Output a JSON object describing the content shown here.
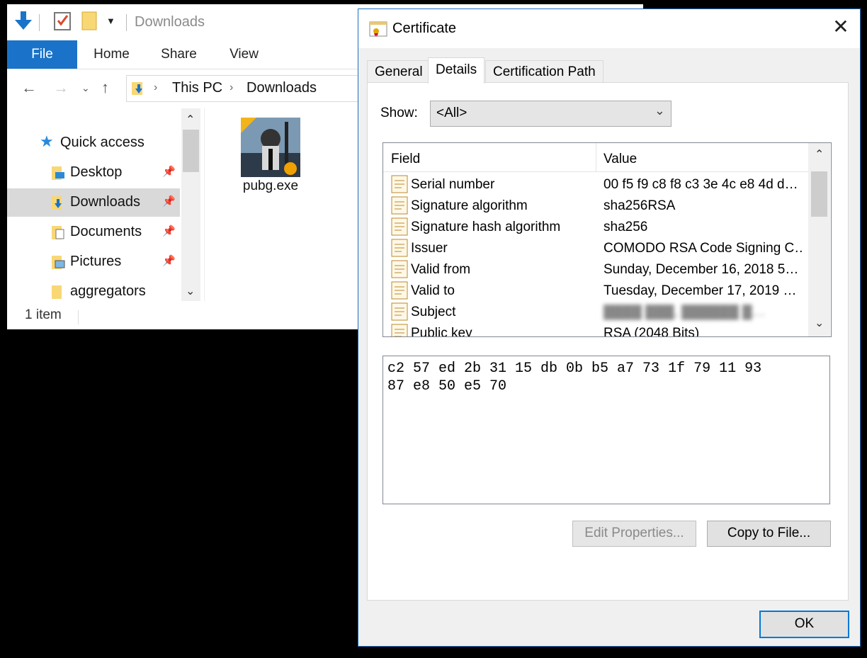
{
  "explorer": {
    "title": "Downloads",
    "ribbon_tabs": [
      "File",
      "Home",
      "Share",
      "View"
    ],
    "breadcrumb": [
      "This PC",
      "Downloads"
    ],
    "quick_access": {
      "label": "Quick access",
      "items": [
        {
          "label": "Desktop",
          "pinned": true
        },
        {
          "label": "Downloads",
          "pinned": true,
          "selected": true
        },
        {
          "label": "Documents",
          "pinned": true
        },
        {
          "label": "Pictures",
          "pinned": true
        },
        {
          "label": "aggregators",
          "pinned": false
        }
      ]
    },
    "files": [
      {
        "name": "pubg.exe",
        "icon": "pubg-game-icon"
      }
    ],
    "status": "1 item"
  },
  "certificate": {
    "title": "Certificate",
    "tabs": [
      "General",
      "Details",
      "Certification Path"
    ],
    "active_tab": "Details",
    "show_label": "Show:",
    "show_value": "<All>",
    "columns": {
      "field": "Field",
      "value": "Value"
    },
    "rows": [
      {
        "field": "Serial number",
        "value": "00 f5 f9 c8 f8 c3 3e 4c e8 4d d…"
      },
      {
        "field": "Signature algorithm",
        "value": "sha256RSA"
      },
      {
        "field": "Signature hash algorithm",
        "value": "sha256"
      },
      {
        "field": "Issuer",
        "value": "COMODO RSA Code Signing C…"
      },
      {
        "field": "Valid from",
        "value": "Sunday, December 16, 2018 5…"
      },
      {
        "field": "Valid to",
        "value": "Tuesday, December 17, 2019 …"
      },
      {
        "field": "Subject",
        "value": "████ ███, ██████ █…",
        "blurred": true
      },
      {
        "field": "Public key",
        "value": "RSA (2048 Bits)"
      }
    ],
    "hex_lines": [
      "c2 57 ed 2b 31 15 db 0b b5 a7 73 1f 79 11 93",
      "87 e8 50 e5 70"
    ],
    "buttons": {
      "edit_properties": "Edit Properties...",
      "copy_to_file": "Copy to File...",
      "ok": "OK"
    }
  }
}
